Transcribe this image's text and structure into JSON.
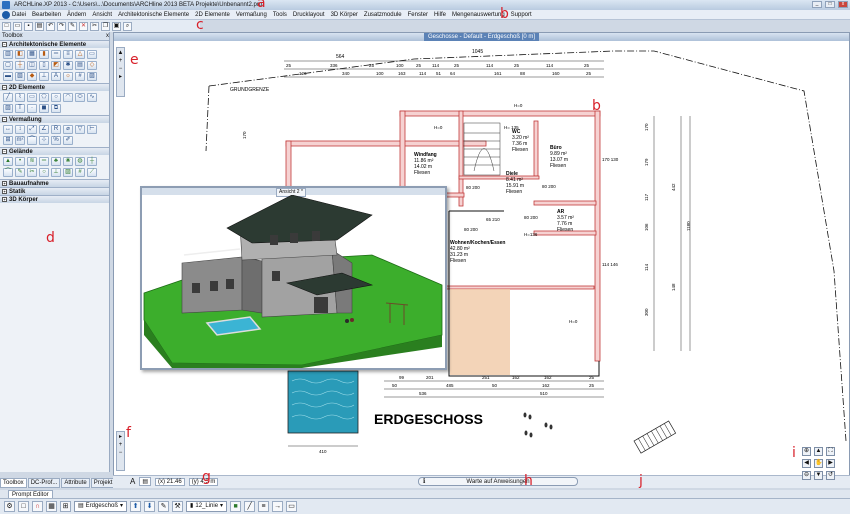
{
  "window": {
    "title": "ARCHLine.XP 2013 - C:\\Users\\...\\Documents\\ARCHline 2013 BETA Projekte\\Unbenannt2.pro",
    "min": "_",
    "max": "□",
    "close": "x"
  },
  "menu": [
    "Datei",
    "Bearbeiten",
    "Ändern",
    "Ansicht",
    "Architektonische Elemente",
    "2D Elemente",
    "Vermaßung",
    "Tools",
    "Drucklayout",
    "3D Körper",
    "Zusatzmodule",
    "Fenster",
    "Hilfe",
    "Mengenauswertung",
    "Support"
  ],
  "toolbar": {
    "icons": [
      "new-icon",
      "open-icon",
      "save-icon",
      "print-icon",
      "undo-icon",
      "redo-icon",
      "eyedropper-icon",
      "close-icon",
      "cut-icon",
      "copy-icon",
      "paste-icon",
      "zoom-icon"
    ]
  },
  "toolbox": {
    "title": "Toolbox",
    "close": "x",
    "sections": [
      {
        "label": "Architektonische Elemente",
        "expanded": true
      },
      {
        "label": "2D Elemente",
        "expanded": true
      },
      {
        "label": "Vermaßung",
        "expanded": true
      },
      {
        "label": "Gelände",
        "expanded": true
      },
      {
        "label": "Bauaufnahme",
        "expanded": false
      },
      {
        "label": "Statik",
        "expanded": false
      },
      {
        "label": "3D Körper",
        "expanded": false
      }
    ],
    "tabs": [
      "Toolbox",
      "DC-Prof...",
      "Attribute",
      "Projekt ..."
    ]
  },
  "drawing": {
    "window_title": "Geschosse - Default - Erdgeschoß [0 m]",
    "floor_label": "ERDGESCHOSS",
    "grundgrenze": "GRUNDGRENZE",
    "rooms": [
      {
        "name": "Windfang",
        "area": "11.86 m²",
        "perim": "14.02 m",
        "floor": "Fliesen"
      },
      {
        "name": "WC",
        "area": "3.20 m²",
        "perim": "7.36 m",
        "floor": "Fliesen"
      },
      {
        "name": "Büro",
        "area": "9.89 m²",
        "perim": "13.07 m",
        "floor": "Fliesen"
      },
      {
        "name": "Diele",
        "area": "8.41 m²",
        "perim": "15.91 m",
        "floor": "Fliesen"
      },
      {
        "name": "AR",
        "area": "3.57 m²",
        "perim": "7.76 m",
        "floor": "Fliesen"
      },
      {
        "name": "Wohnen/Kochen/Essen",
        "area": "42.80 m²",
        "perim": "31.23 m",
        "floor": "Fliesen"
      }
    ],
    "dims_top1": [
      "564",
      "1045"
    ],
    "dims_top2": [
      "25",
      "336",
      "25",
      "100",
      "25",
      "114",
      "25",
      "114",
      "25",
      "114",
      "25"
    ],
    "dims_top3": [
      "126",
      "340",
      "100",
      "163",
      "114",
      "51",
      "64",
      "161",
      "88",
      "160",
      "25"
    ],
    "dims_bottom1": [
      "99",
      "201",
      "251",
      "162",
      "162",
      "25"
    ],
    "dims_bottom2": [
      "50",
      "485",
      "50",
      "162",
      "25"
    ],
    "dims_bottom3": [
      "536",
      "510"
    ],
    "dim_pool": "410",
    "dims_right": [
      "170",
      "179",
      "117",
      "106",
      "114",
      "300",
      "442",
      "148",
      "1180"
    ],
    "dims_left": [
      "170"
    ],
    "openings": [
      "80 200",
      "80 200",
      "80 200",
      "80 200",
      "65 210",
      "210 210",
      "170 130",
      "114 146",
      "H=0",
      "H=0",
      "H=0",
      "H= 135",
      "H=136"
    ]
  },
  "view3d": {
    "title": "Ansicht 2 *"
  },
  "status": {
    "coord_x": "(x) 21.46",
    "coord_y": "(y) 4.5 m",
    "message": "Warte auf Anweisungen",
    "info": "i"
  },
  "prompt_editor": "Prompt Editor",
  "bottombar": {
    "layer": "Erdgeschoß",
    "linetype": "12_Linie"
  },
  "annotations": [
    "a",
    "b",
    "c",
    "b",
    "e",
    "d",
    "f",
    "g",
    "h",
    "i",
    "j"
  ],
  "colors": {
    "wall": "#e06666",
    "terrain": "#3cae2c",
    "annotation": "#d8202a",
    "accent": "#5b82b6"
  }
}
